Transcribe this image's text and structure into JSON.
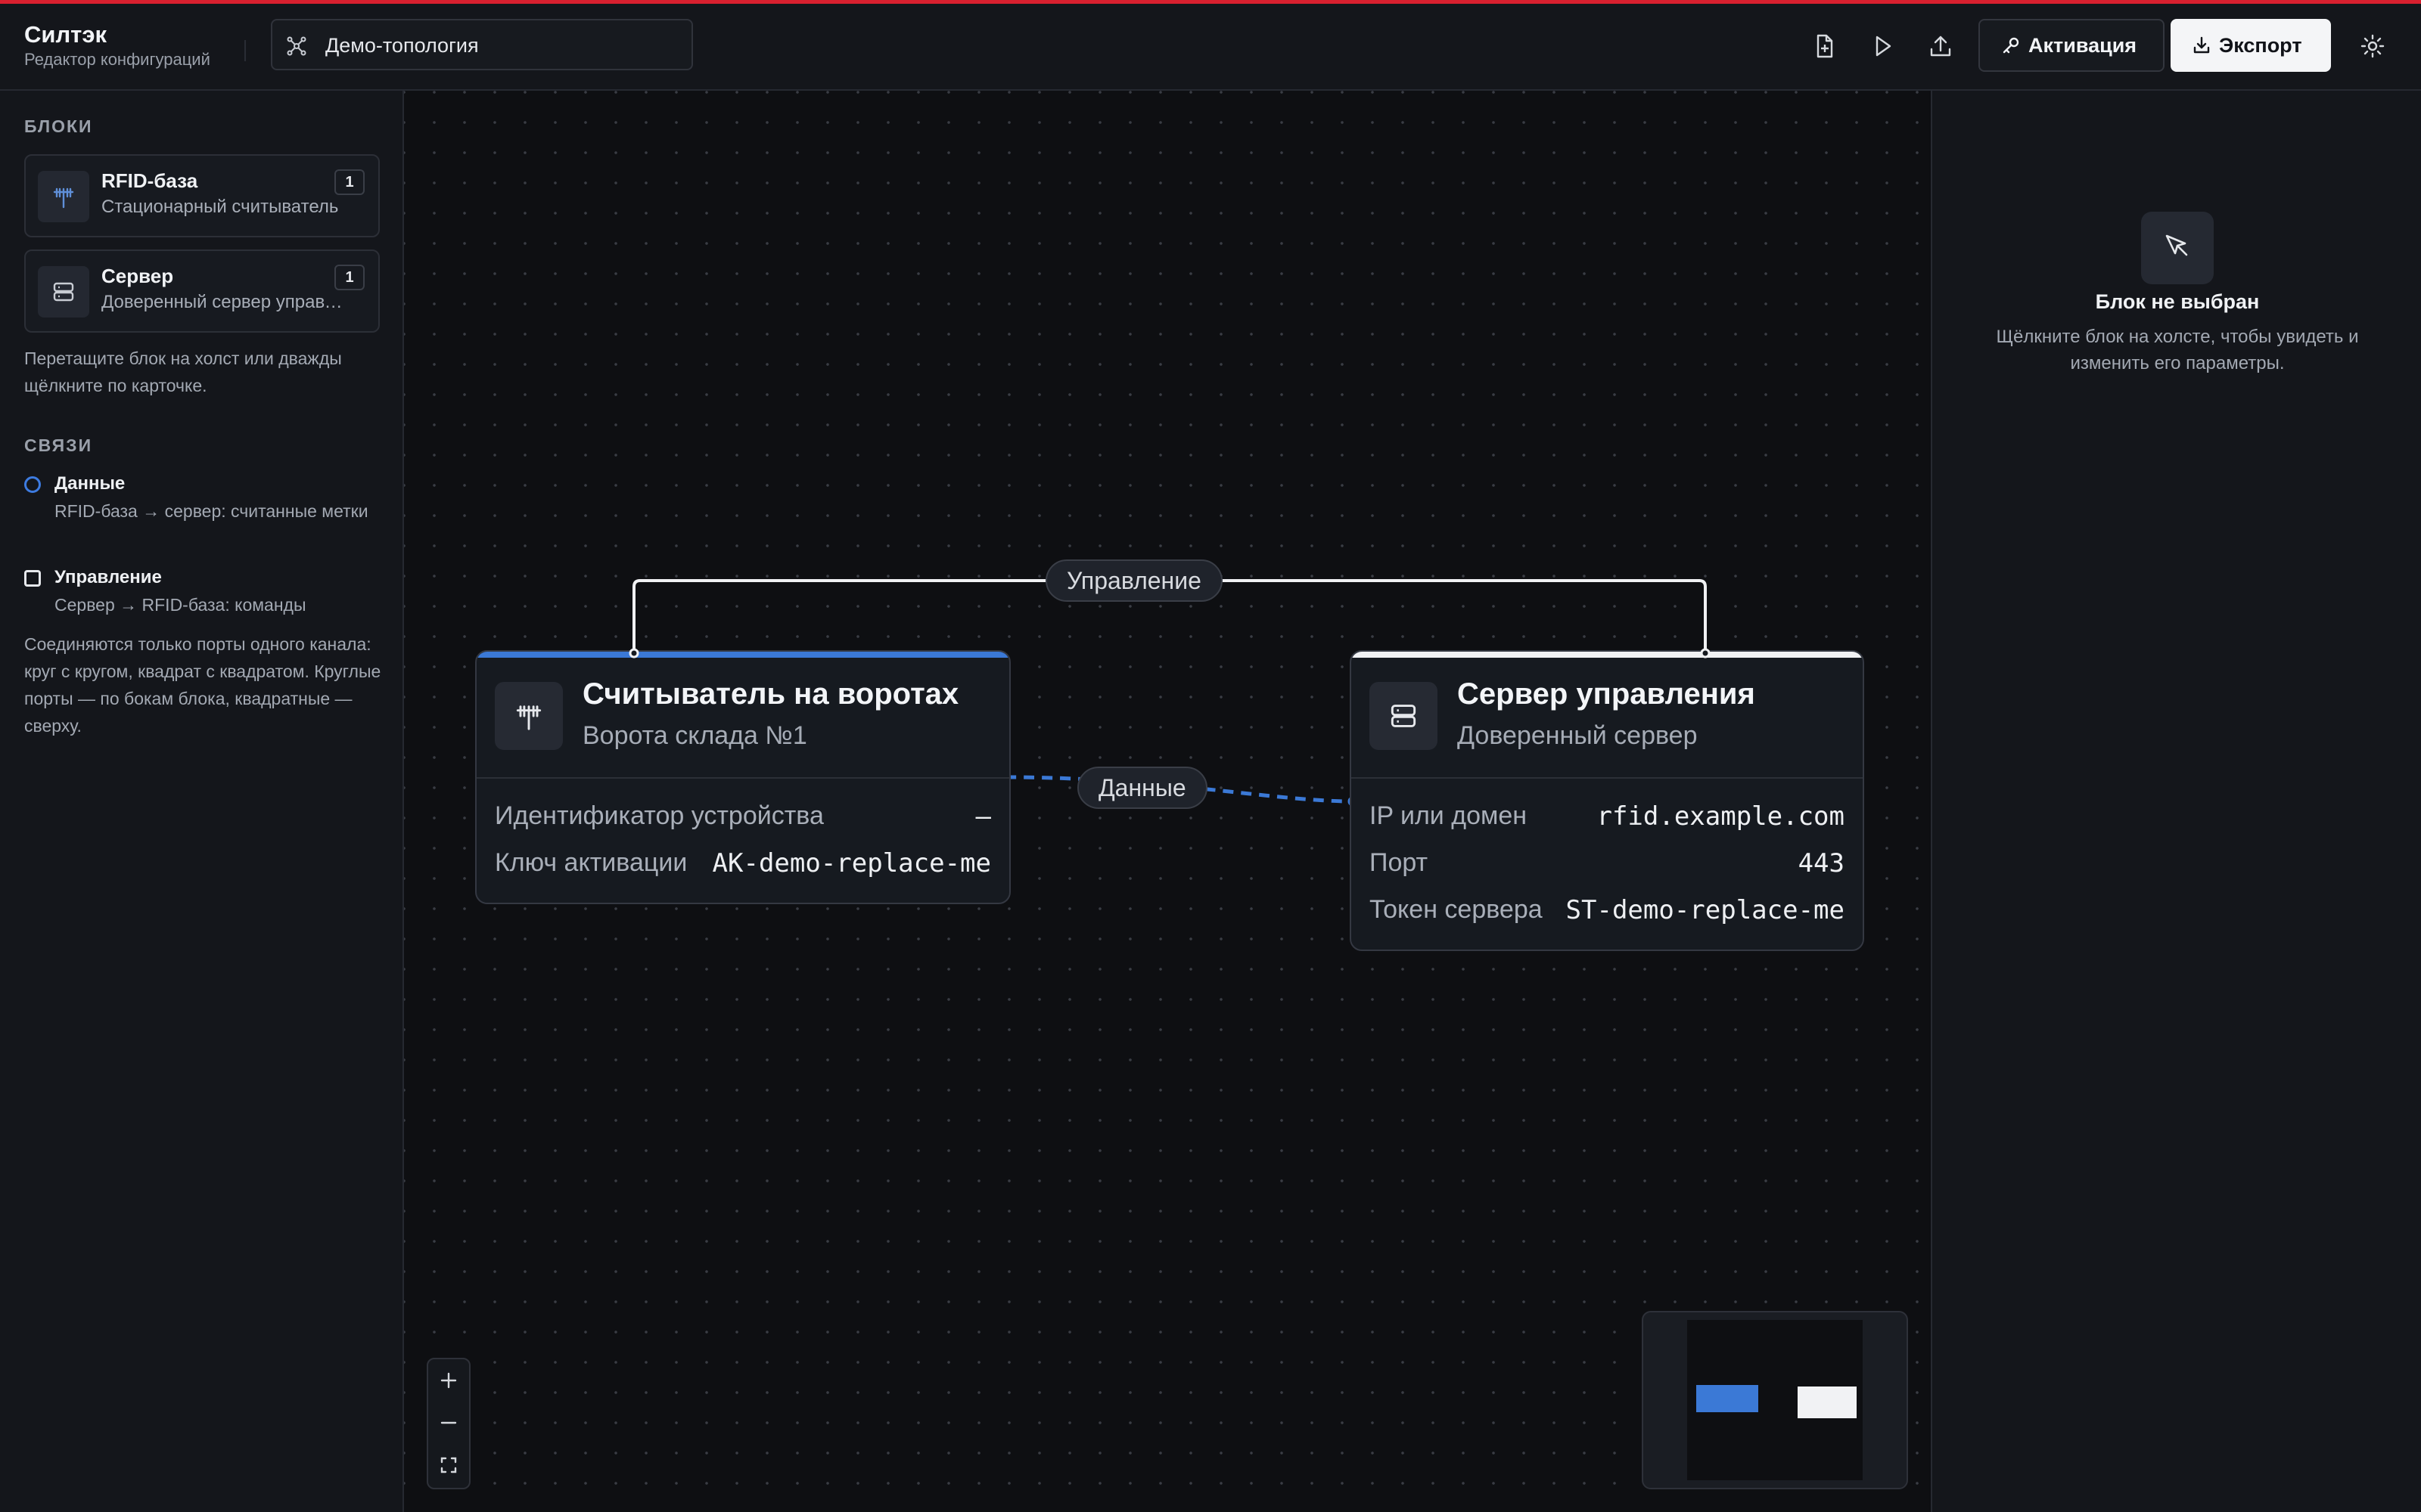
{
  "header": {
    "app_title": "Силтэк",
    "app_subtitle": "Редактор конфигураций",
    "project_name": "Демо-топология",
    "activate_label": "Активация",
    "export_label": "Экспорт",
    "icons": [
      "add-file-icon",
      "play-icon",
      "upload-icon",
      "key-icon",
      "download-icon",
      "sun-icon"
    ]
  },
  "sidebar": {
    "blocks_title": "БЛОКИ",
    "blocks": [
      {
        "title": "RFID-база",
        "subtitle": "Стационарный считыватель",
        "count": "1",
        "icon": "antenna-icon"
      },
      {
        "title": "Сервер",
        "subtitle": "Доверенный сервер управления",
        "count": "1",
        "icon": "server-icon"
      }
    ],
    "blocks_hint": "Перетащите блок на холст или дважды щёлкните по карточке.",
    "links_title": "СВЯЗИ",
    "links": [
      {
        "title": "Данные",
        "desc": "RFID-база → сервер: считанные метки",
        "marker": "circle"
      },
      {
        "title": "Управление",
        "desc": "Сервер → RFID-база: команды",
        "marker": "square"
      }
    ],
    "links_hint": "Соединяются только порты одного канала: круг с кругом, квадрат с квадратом. Круглые порты — по бокам блока, квадратные — сверху."
  },
  "canvas": {
    "edges": {
      "control_label": "Управление",
      "data_label": "Данные"
    },
    "nodes": {
      "reader": {
        "title": "Считыватель на воротах",
        "subtitle": "Ворота склада №1",
        "accent": "#3b79d6",
        "props": [
          {
            "key": "Идентификатор устройства",
            "value": "—"
          },
          {
            "key": "Ключ активации",
            "value": "AK-demo-replace-me"
          }
        ]
      },
      "server": {
        "title": "Сервер управления",
        "subtitle": "Доверенный сервер",
        "accent": "#f1f2f4",
        "props": [
          {
            "key": "IP или домен",
            "value": "rfid.example.com"
          },
          {
            "key": "Порт",
            "value": "443"
          },
          {
            "key": "Токен сервера",
            "value": "ST-demo-replace-me"
          }
        ]
      }
    },
    "zoom_controls": [
      "zoom-in",
      "zoom-out",
      "fit-view"
    ]
  },
  "inspector": {
    "empty_title": "Блок не выбран",
    "empty_text": "Щёлкните блок на холсте, чтобы увидеть и изменить его параметры."
  },
  "colors": {
    "accent_blue": "#3b79d6",
    "top_line_red": "#d8202f",
    "background": "#0d0e11"
  }
}
